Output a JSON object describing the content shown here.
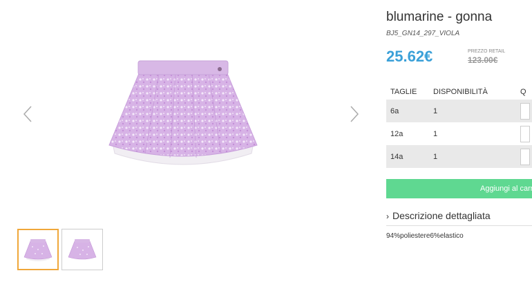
{
  "product": {
    "title": "blumarine - gonna",
    "sku": "BJ5_GN14_297_VIOLA",
    "price": "25.62€",
    "retail_label": "PREZZO RETAIL",
    "retail_price": "123.00€"
  },
  "table": {
    "headers": [
      "TAGLIE",
      "DISPONIBILITÀ",
      "Q"
    ],
    "rows": [
      {
        "size": "6a",
        "availability": "1"
      },
      {
        "size": "12a",
        "availability": "1"
      },
      {
        "size": "14a",
        "availability": "1"
      }
    ]
  },
  "cart": {
    "button_label": "Aggiungi al carr"
  },
  "description": {
    "heading": "Descrizione dettagliata",
    "text": "94%poliestere6%elastico"
  },
  "colors": {
    "price": "#3aa0d8",
    "cart_button": "#5fd891",
    "thumb_active": "#f0a73a",
    "skirt": "#d9b4e6"
  },
  "icons": {
    "prev": "chevron-left-icon",
    "next": "chevron-right-icon",
    "desc": "chevron-right-icon"
  }
}
